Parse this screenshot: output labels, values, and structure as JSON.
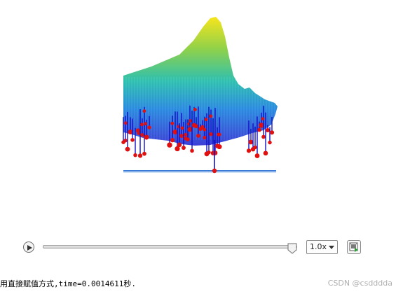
{
  "player": {
    "speed_value": "1.0x",
    "progress_fraction": 1.0
  },
  "console": {
    "output_text": "用直接赋值方式,time=0.0014611秒."
  },
  "watermark": {
    "text": "CSDN @csdddda"
  },
  "colors": {
    "surface_peak": "#f7e51c",
    "surface_mid": "#2ec0b0",
    "surface_low": "#3c3fd6",
    "stem_color": "#1010c8",
    "marker_color": "#e11010",
    "baseline_color": "#3a7ad8"
  },
  "icons": [
    "play-icon",
    "slider-thumb-icon",
    "chevron-down-icon",
    "export-video-icon"
  ]
}
